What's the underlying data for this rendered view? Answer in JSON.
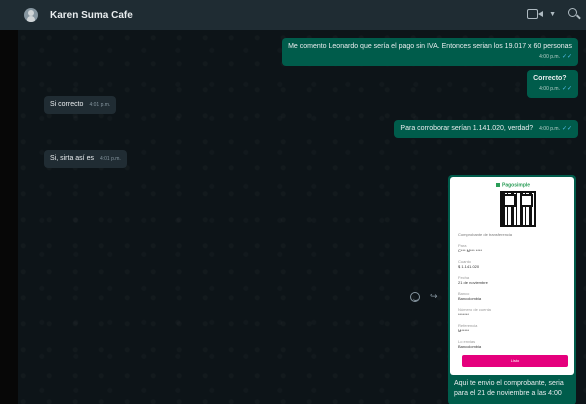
{
  "header": {
    "contact_name": "Karen Suma Cafe"
  },
  "messages": [
    {
      "direction": "out",
      "text": "Me comento Leonardo que sería el pago sin IVA. Entonces serian los 19.017 x 60 personas",
      "time": "4:00 p.m."
    },
    {
      "direction": "out",
      "text": "Correcto?",
      "time": "4:00 p.m."
    },
    {
      "direction": "in",
      "text": "Si correcto",
      "time": "4:01 p.m."
    },
    {
      "direction": "out",
      "text": "Para corroborar serían 1.141.020, verdad?",
      "time": "4:00 p.m."
    },
    {
      "direction": "in",
      "text": "Si, sirta así es",
      "time": "4:01 p.m."
    }
  ],
  "receipt": {
    "brand": "Pagosimple",
    "note": "Comprobante de transferencia",
    "rows": [
      {
        "label": "Para",
        "value": "C*** M*** ****"
      },
      {
        "label": "Cuanto",
        "value": "$ 1.141.020"
      },
      {
        "label": "Fecha",
        "value": "21 de noviembre"
      },
      {
        "label": "Banco",
        "value": "Bancolombia"
      },
      {
        "label": "Número de cuenta",
        "value": "*******"
      },
      {
        "label": "Referencia",
        "value": "M*****"
      },
      {
        "label": "Lo envias",
        "value": "Bancolombia"
      }
    ],
    "button_label": "Listo",
    "caption": "Aqui te envio el comprobante, seria para el 21 de noviembre a las 4:00"
  },
  "colors": {
    "header_bg": "#1f2c33",
    "outgoing_bubble": "#005c4b",
    "incoming_bubble": "#202c33",
    "chat_bg": "#0d1418",
    "accent_button": "#e5007d"
  },
  "icons": {
    "header": [
      "avatar-icon",
      "video-call-icon",
      "chevron-down-icon",
      "search-icon"
    ],
    "message": [
      "emoji-icon",
      "forward-icon"
    ]
  }
}
